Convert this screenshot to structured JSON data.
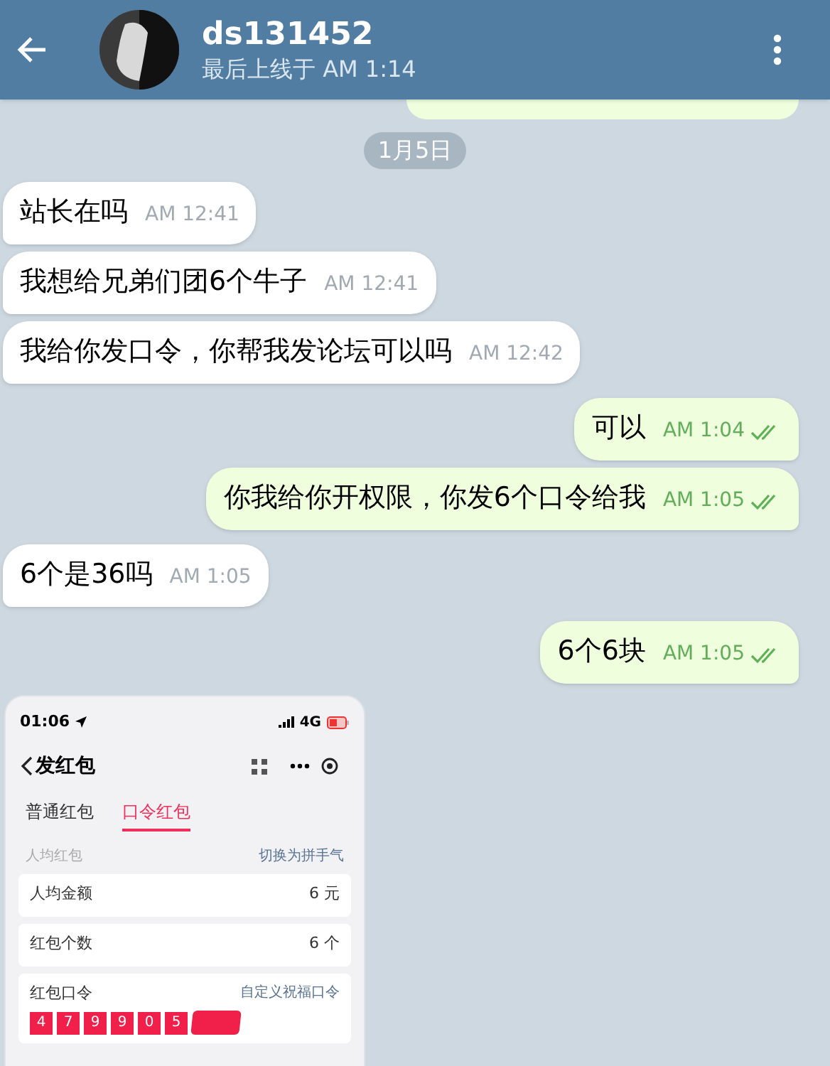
{
  "header": {
    "title": "ds131452",
    "subtitle": "最后上线于 AM 1:14"
  },
  "date_chip": "1月5日",
  "messages": [
    {
      "kind": "incoming",
      "text": "站长在吗",
      "time": "AM 12:41"
    },
    {
      "kind": "incoming",
      "text": "我想给兄弟们团6个牛子",
      "time": "AM 12:41"
    },
    {
      "kind": "incoming",
      "text": "我给你发口令，你帮我发论坛可以吗",
      "time": "AM 12:42"
    },
    {
      "kind": "outgoing",
      "text": "可以",
      "time": "AM 1:04",
      "read": true
    },
    {
      "kind": "outgoing",
      "text": "你我给你开权限，你发6个口令给我",
      "time": "AM 1:05",
      "read": true
    },
    {
      "kind": "incoming",
      "text": "6个是36吗",
      "time": "AM 1:05"
    },
    {
      "kind": "outgoing",
      "text": "6个6块",
      "time": "AM 1:05",
      "read": true
    }
  ],
  "screenshot": {
    "clock": "01:06",
    "network": "4G",
    "title": "发红包",
    "tabs": [
      {
        "label": "普通红包",
        "selected": false
      },
      {
        "label": "口令红包",
        "selected": true
      }
    ],
    "section_label": "人均红包",
    "switch_link": "切换为拼手气",
    "rows": [
      {
        "label": "人均金额",
        "value": "6 元"
      },
      {
        "label": "红包个数",
        "value": "6 个"
      }
    ],
    "code_label": "红包口令",
    "custom_link": "自定义祝福口令",
    "code_digits": [
      "4",
      "7",
      "9",
      "9",
      "0",
      "5"
    ]
  }
}
